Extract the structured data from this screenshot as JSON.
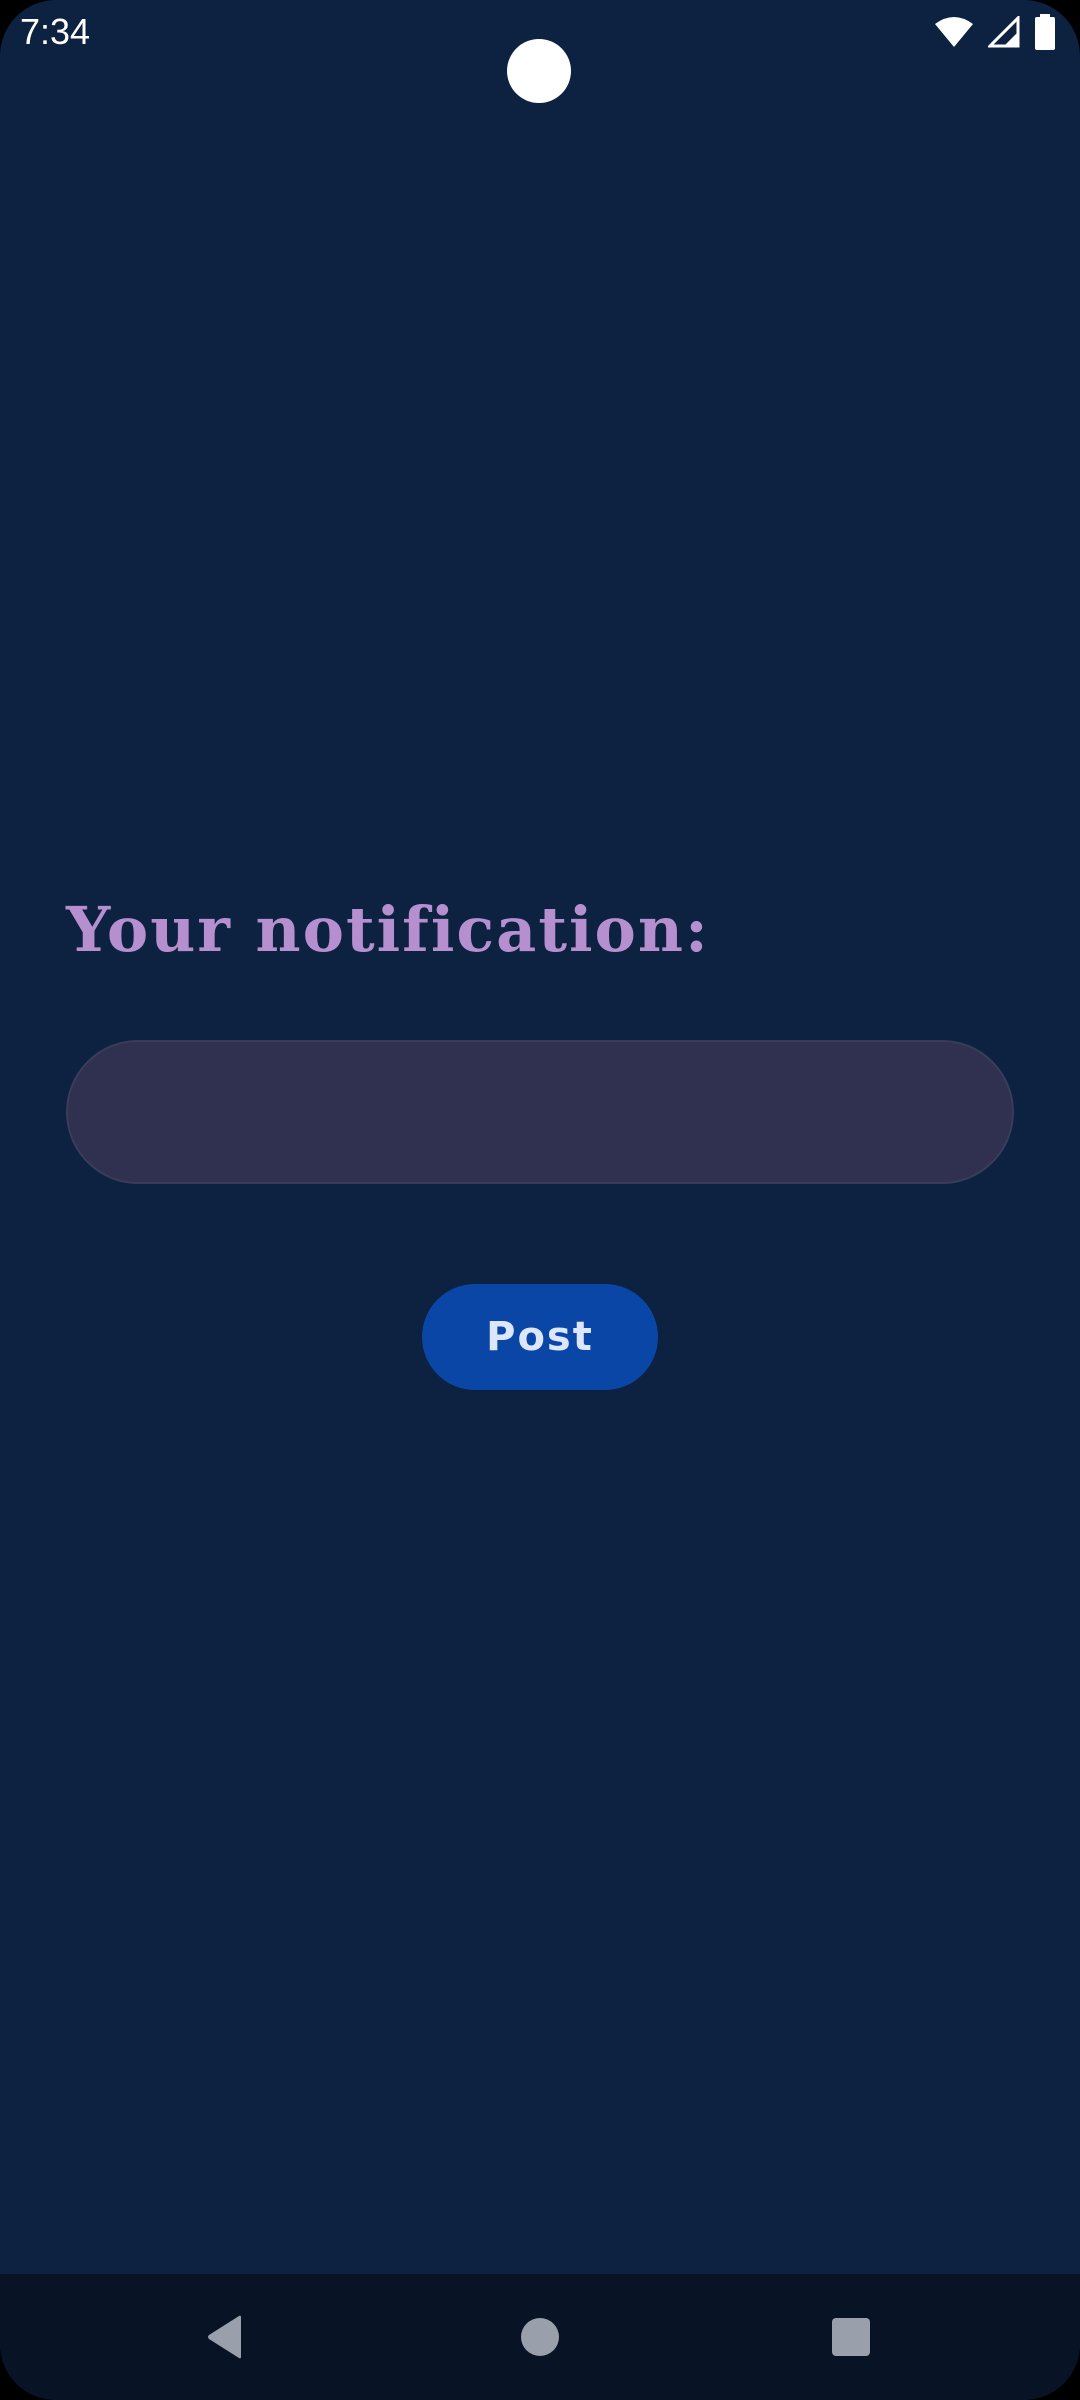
{
  "status_bar": {
    "time": "7:34",
    "icons": [
      "wifi-icon",
      "cell-signal-icon",
      "battery-icon"
    ]
  },
  "main": {
    "heading": "Your notification:",
    "input": {
      "value": "",
      "placeholder": ""
    },
    "post_button_label": "Post"
  },
  "nav_bar": {
    "icons": [
      "back-icon",
      "home-icon",
      "recents-icon"
    ]
  },
  "colors": {
    "background": "#0d2141",
    "heading": "#b68fce",
    "input_background": "#303150",
    "button_background": "#0a46a5",
    "button_text": "#dde6ff",
    "nav_bar_background": "#081426",
    "nav_icon": "#9aa0ab"
  }
}
